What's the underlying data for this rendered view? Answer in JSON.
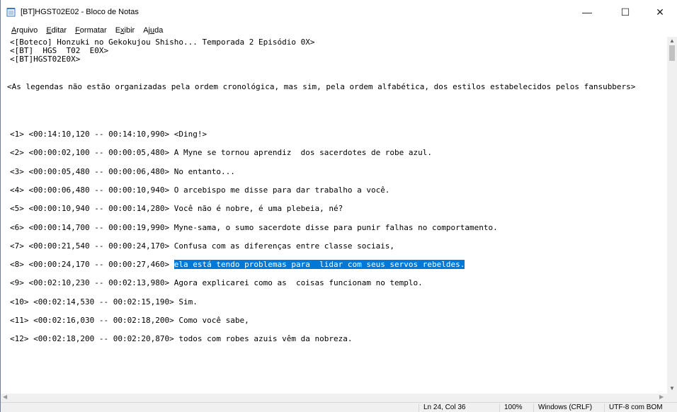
{
  "window": {
    "title": "[BT]HGST02E02 - Bloco de Notas",
    "minimize": "—",
    "maximize": "☐",
    "close": "✕"
  },
  "menu": [
    {
      "pre": "",
      "u": "A",
      "post": "rquivo"
    },
    {
      "pre": "",
      "u": "E",
      "post": "ditar"
    },
    {
      "pre": "",
      "u": "F",
      "post": "ormatar"
    },
    {
      "pre": "E",
      "u": "x",
      "post": "ibir"
    },
    {
      "pre": "Aj",
      "u": "u",
      "post": "da"
    }
  ],
  "editor": {
    "header1": "<[Boteco] Honzuki no Gekokujou Shisho... Temporada 2 Episódio 0X>",
    "header2": "<[BT]  HGS  T02  E0X>",
    "header3": "<[BT]HGST02E0X>",
    "note": "<As legendas não estão organizadas pela ordem cronológica, mas sim, pela ordem alfabética, dos estilos estabelecidos pelos fansubbers>",
    "lines": [
      {
        "prefix": "<1> <00:14:10,120 -- 00:14:10,990> ",
        "text": "<Ding!>",
        "selected": false
      },
      {
        "prefix": "<2> <00:00:02,100 -- 00:00:05,480> ",
        "text": "A Myne se tornou aprendiz  dos sacerdotes de robe azul.",
        "selected": false
      },
      {
        "prefix": "<3> <00:00:05,480 -- 00:00:06,480> ",
        "text": "No entanto...",
        "selected": false
      },
      {
        "prefix": "<4> <00:00:06,480 -- 00:00:10,940> ",
        "text": "O arcebispo me disse para dar trabalho a você.",
        "selected": false
      },
      {
        "prefix": "<5> <00:00:10,940 -- 00:00:14,280> ",
        "text": "Você não é nobre, é uma plebeia, né?",
        "selected": false
      },
      {
        "prefix": "<6> <00:00:14,700 -- 00:00:19,990> ",
        "text": "Myne-sama, o sumo sacerdote disse para punir falhas no comportamento.",
        "selected": false
      },
      {
        "prefix": "<7> <00:00:21,540 -- 00:00:24,170> ",
        "text": "Confusa com as diferenças entre classe sociais,",
        "selected": false
      },
      {
        "prefix": "<8> <00:00:24,170 -- 00:00:27,460> ",
        "text": "ela está tendo problemas para  lidar com seus servos rebeldes.",
        "selected": true
      },
      {
        "prefix": "<9> <00:02:10,230 -- 00:02:13,980> ",
        "text": "Agora explicarei como as  coisas funcionam no templo.",
        "selected": false
      },
      {
        "prefix": "<10> <00:02:14,530 -- 00:02:15,190> ",
        "text": "Sim.",
        "selected": false
      },
      {
        "prefix": "<11> <00:02:16,030 -- 00:02:18,200> ",
        "text": "Como você sabe,",
        "selected": false
      },
      {
        "prefix": "<12> <00:02:18,200 -- 00:02:20,870> ",
        "text": "todos com robes azuis vêm da nobreza.",
        "selected": false
      }
    ]
  },
  "status": {
    "position": "Ln 24, Col 36",
    "zoom": "100%",
    "line_ending": "Windows (CRLF)",
    "encoding": "UTF-8 com BOM"
  }
}
